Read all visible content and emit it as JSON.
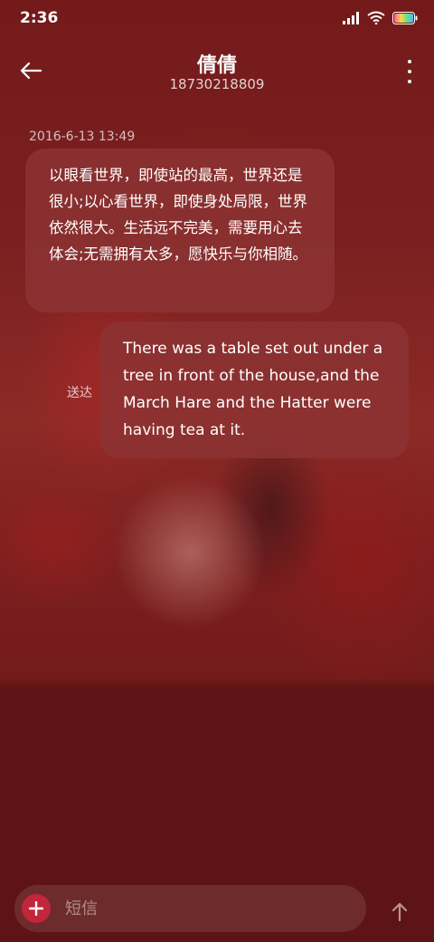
{
  "status_bar": {
    "time": "2:36",
    "icons": [
      "signal-icon",
      "wifi-icon",
      "battery-icon"
    ]
  },
  "header": {
    "contact_name": "倩倩",
    "contact_number": "18730218809",
    "back_icon": "arrow-left-icon",
    "more_icon": "more-vertical-icon"
  },
  "conversation": {
    "timestamp": "2016-6-13 13:49",
    "messages": [
      {
        "direction": "incoming",
        "text": "以眼看世界，即使站的最高，世界还是很小;以心看世界，即使身处局限，世界依然很大。生活远不完美，需要用心去体会;无需拥有太多，愿快乐与你相随。"
      },
      {
        "direction": "outgoing",
        "text": "There was a table set out under a tree in front of the house,and the March Hare and the Hatter were having tea at it.",
        "status": "送达"
      }
    ]
  },
  "composer": {
    "placeholder": "短信",
    "add_icon": "plus-icon",
    "send_icon": "arrow-up-icon"
  },
  "colors": {
    "background": "#6a1515",
    "bubble": "#8c3232",
    "add_button": "#c3253a"
  }
}
